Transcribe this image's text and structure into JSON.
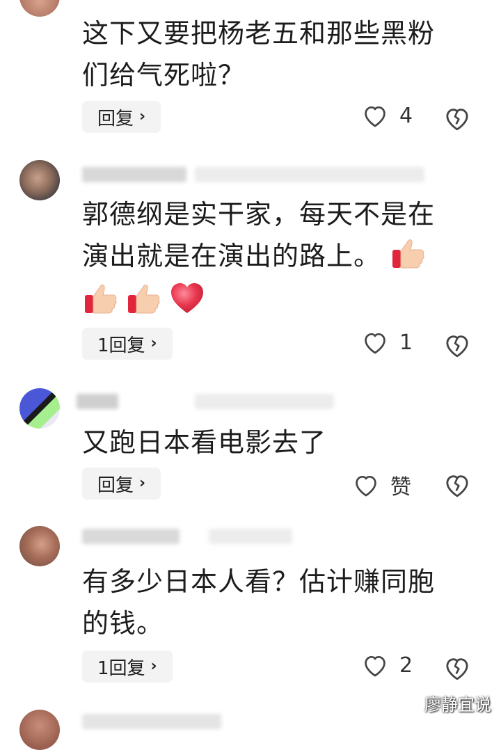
{
  "colors": {
    "text": "#1c1c1c",
    "reply_bg": "#f3f3f3",
    "icon_stroke": "#444444",
    "heart_red": "#e8374f",
    "thumb_skin": "#f7cfae",
    "cuff_red": "#e0263c"
  },
  "comments": [
    {
      "text_line1": "这下又要把杨老五和那些黑粉",
      "text_line2": "们给气死啦？",
      "reply_label": "回复",
      "like_count": "4"
    },
    {
      "text_line1": "郭德纲是实干家，每天不是在",
      "text_line2": "演出就是在演出的路上。",
      "emojis": [
        "thumbs-up",
        "thumbs-up",
        "thumbs-up",
        "red-heart"
      ],
      "reply_label": "1回复",
      "like_count": "1"
    },
    {
      "text_line1": "又跑日本看电影去了",
      "reply_label": "回复",
      "like_count": "赞"
    },
    {
      "text_line1": "有多少日本人看？估计赚同胞",
      "text_line2": "的钱。",
      "reply_label": "1回复",
      "like_count": "2"
    }
  ],
  "icons": {
    "like": "heart-outline-icon",
    "dislike": "broken-heart-icon",
    "chevron": "chevron-right-icon"
  },
  "watermark": "廖静宜说"
}
